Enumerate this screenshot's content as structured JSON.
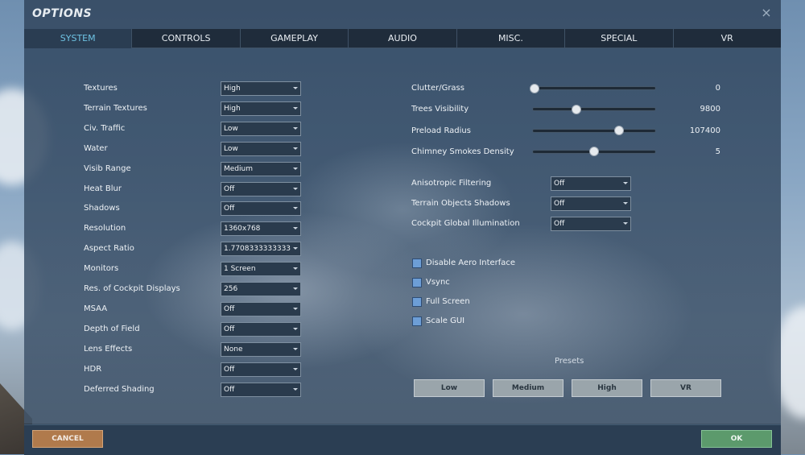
{
  "window": {
    "title": "OPTIONS",
    "close_icon": "×"
  },
  "tabs": [
    {
      "label": "SYSTEM",
      "active": true
    },
    {
      "label": "CONTROLS",
      "active": false
    },
    {
      "label": "GAMEPLAY",
      "active": false
    },
    {
      "label": "AUDIO",
      "active": false
    },
    {
      "label": "MISC.",
      "active": false
    },
    {
      "label": "SPECIAL",
      "active": false
    },
    {
      "label": "VR",
      "active": false
    }
  ],
  "left_settings": [
    {
      "label": "Textures",
      "value": "High"
    },
    {
      "label": "Terrain Textures",
      "value": "High"
    },
    {
      "label": "Civ. Traffic",
      "value": "Low"
    },
    {
      "label": "Water",
      "value": "Low"
    },
    {
      "label": "Visib Range",
      "value": "Medium"
    },
    {
      "label": "Heat Blur",
      "value": "Off"
    },
    {
      "label": "Shadows",
      "value": "Off"
    },
    {
      "label": "Resolution",
      "value": "1360x768"
    },
    {
      "label": "Aspect Ratio",
      "value": "1.7708333333333"
    },
    {
      "label": "Monitors",
      "value": "1 Screen"
    },
    {
      "label": "Res. of Cockpit Displays",
      "value": "256"
    },
    {
      "label": "MSAA",
      "value": "Off"
    },
    {
      "label": "Depth of Field",
      "value": "Off"
    },
    {
      "label": "Lens Effects",
      "value": "None"
    },
    {
      "label": "HDR",
      "value": "Off"
    },
    {
      "label": "Deferred Shading",
      "value": "Off"
    }
  ],
  "sliders": [
    {
      "label": "Clutter/Grass",
      "value": "0",
      "level": 0.02
    },
    {
      "label": "Trees Visibility",
      "value": "9800",
      "level": 0.36
    },
    {
      "label": "Preload Radius",
      "value": "107400",
      "level": 0.7
    },
    {
      "label": "Chimney Smokes Density",
      "value": "5",
      "level": 0.5
    }
  ],
  "right_dropdowns": [
    {
      "label": "Anisotropic Filtering",
      "value": "Off"
    },
    {
      "label": "Terrain Objects Shadows",
      "value": "Off"
    },
    {
      "label": "Cockpit Global Illumination",
      "value": "Off"
    }
  ],
  "checkboxes": [
    {
      "label": "Disable Aero Interface"
    },
    {
      "label": "Vsync"
    },
    {
      "label": "Full Screen"
    },
    {
      "label": "Scale GUI"
    }
  ],
  "presets": {
    "label": "Presets",
    "buttons": [
      "Low",
      "Medium",
      "High",
      "VR"
    ]
  },
  "footer": {
    "cancel": "CANCEL",
    "ok": "OK"
  },
  "colors": {
    "active_tab": "#6ec3e3",
    "cancel": "#b07a4c",
    "ok": "#5c9a6c",
    "checkbox": "#6d9ed6"
  }
}
